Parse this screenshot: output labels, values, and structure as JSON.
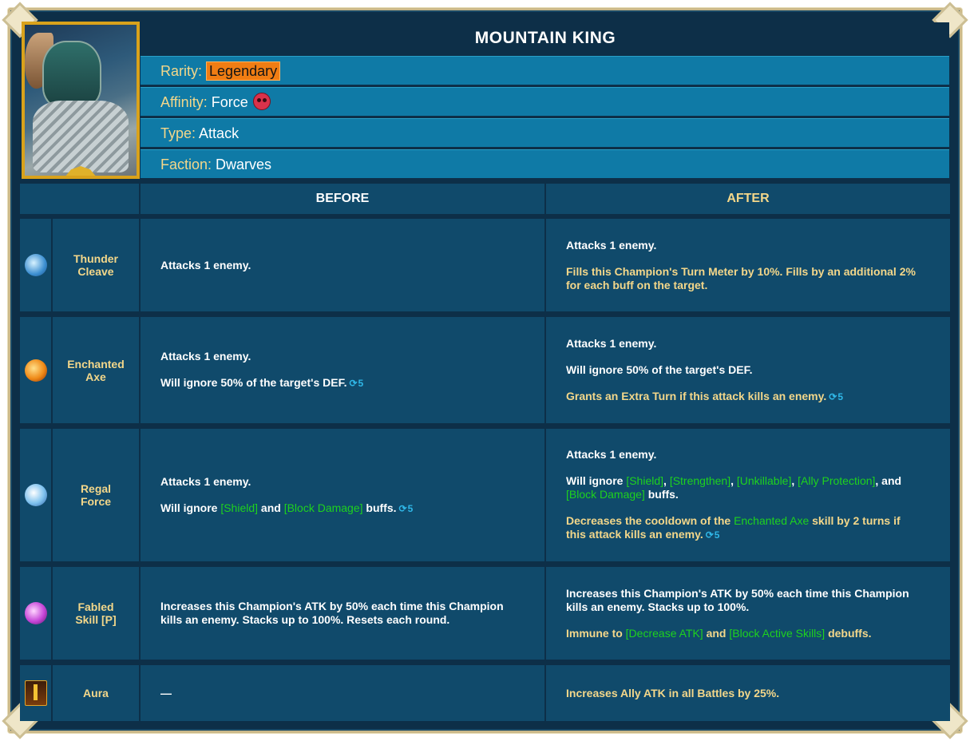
{
  "champion": {
    "name": "MOUNTAIN KING",
    "rarity_label": "Rarity:",
    "rarity": "Legendary",
    "affinity_label": "Affinity:",
    "affinity": "Force",
    "affinity_icon": "skull-icon",
    "type_label": "Type:",
    "type": "Attack",
    "faction_label": "Faction:",
    "faction": "Dwarves"
  },
  "columns": {
    "before": "BEFORE",
    "after": "AFTER"
  },
  "colors": {
    "frame": "#cbb98a",
    "panel": "#0d2f48",
    "cell": "#104a6b",
    "info_row": "#0f7aa6",
    "gold_text": "#f3d78a",
    "green_text": "#1ed21e",
    "badge": "#f07d13",
    "cooldown": "#2fb6e6"
  },
  "skills": [
    {
      "name": "Thunder Cleave",
      "icon": "thunder-cleave-icon",
      "before": {
        "line1": "Attacks 1 enemy."
      },
      "after": {
        "line1": "Attacks 1 enemy.",
        "line2": "Fills this Champion's Turn Meter by 10%. Fills by an additional 2% for each buff on the target."
      }
    },
    {
      "name": "Enchanted Axe",
      "icon": "enchanted-axe-icon",
      "before": {
        "line1": "Attacks 1 enemy.",
        "line2": "Will ignore 50% of the target's DEF.",
        "cooldown": "5"
      },
      "after": {
        "line1": "Attacks 1 enemy.",
        "line2": "Will ignore 50% of the target's DEF.",
        "line3": "Grants an Extra Turn if this attack kills an enemy.",
        "cooldown": "5"
      }
    },
    {
      "name": "Regal Force",
      "icon": "regal-force-icon",
      "before": {
        "line1": "Attacks 1 enemy.",
        "line2_a": "Will ignore ",
        "shield": "[Shield]",
        "and": " and ",
        "block_damage": "[Block Damage]",
        "line2_b": " buffs.",
        "cooldown": "5"
      },
      "after": {
        "line1": "Attacks 1 enemy.",
        "line2_a": "Will ignore ",
        "shield": "[Shield]",
        "comma1": ", ",
        "strengthen": "[Strengthen]",
        "comma2": ", ",
        "unkillable": "[Unkillable]",
        "comma3": ", ",
        "ally_protection": "[Ally Protection]",
        "comma4": ", and ",
        "block_damage": "[Block Damage]",
        "line2_b": " buffs.",
        "line3_a": "Decreases the cooldown of the ",
        "skill_ref": "Enchanted Axe",
        "line3_b": " skill by 2 turns if this attack kills an enemy.",
        "cooldown": "5"
      }
    },
    {
      "name": "Fabled Skill [P]",
      "icon": "fabled-skill-icon",
      "before": {
        "line1": "Increases this Champion's ATK by 50% each time this Champion kills an enemy. Stacks up to 100%. Resets each round."
      },
      "after": {
        "line1": "Increases this Champion's ATK by 50% each time this Champion kills an enemy. Stacks up to 100%.",
        "line2_a": "Immune to ",
        "decrease_atk": "[Decrease ATK]",
        "and": " and ",
        "block_active": "[Block Active Skills]",
        "line2_b": " debuffs."
      }
    },
    {
      "name": "Aura",
      "icon": "aura-icon",
      "before": {
        "line1": "—"
      },
      "after": {
        "line1": "Increases Ally ATK in all Battles by 25%."
      }
    }
  ]
}
